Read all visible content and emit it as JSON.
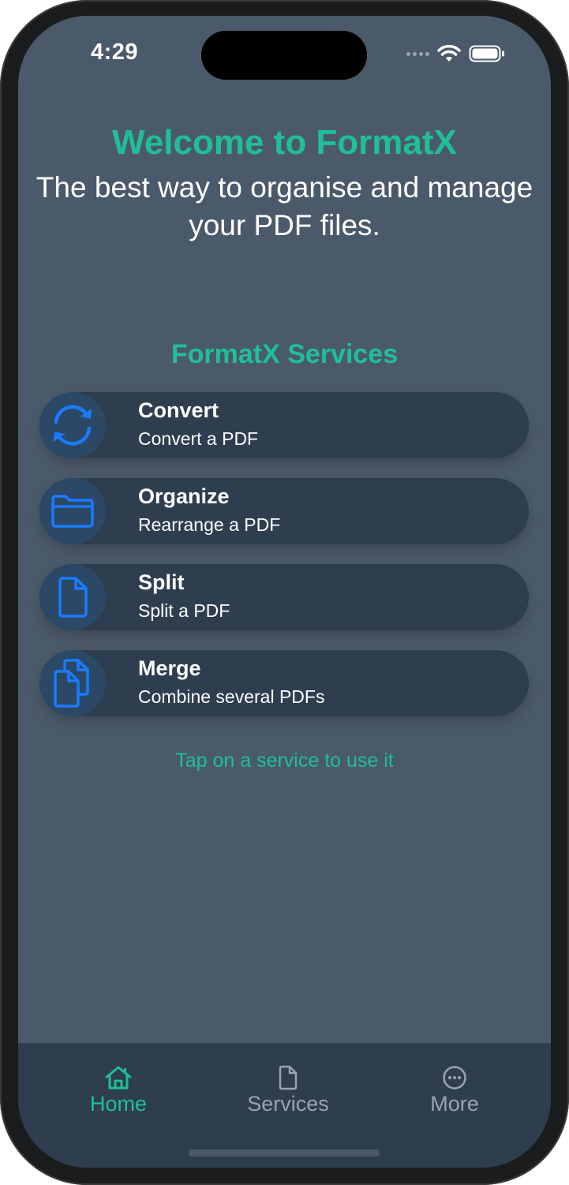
{
  "status_bar": {
    "time": "4:29"
  },
  "header": {
    "title": "Welcome to FormatX",
    "subtitle": "The best way to organise and manage your PDF files."
  },
  "services": {
    "title": "FormatX Services",
    "items": [
      {
        "name": "Convert",
        "description": "Convert a PDF",
        "icon": "arrows-rotate-icon"
      },
      {
        "name": "Organize",
        "description": "Rearrange a PDF",
        "icon": "folder-icon"
      },
      {
        "name": "Split",
        "description": "Split a PDF",
        "icon": "document-icon"
      },
      {
        "name": "Merge",
        "description": "Combine several PDFs",
        "icon": "documents-icon"
      }
    ],
    "hint": "Tap on a service to use it"
  },
  "tabbar": {
    "tabs": [
      {
        "label": "Home",
        "icon": "house-icon",
        "active": true
      },
      {
        "label": "Services",
        "icon": "document-icon",
        "active": false
      },
      {
        "label": "More",
        "icon": "ellipsis-circle-icon",
        "active": false
      }
    ]
  },
  "colors": {
    "accent": "#1fbf97",
    "icon_blue": "#1a7bff",
    "background": "#4b5a6a",
    "card": "#2e3e4f",
    "inactive_tab": "#9aa3ad"
  }
}
